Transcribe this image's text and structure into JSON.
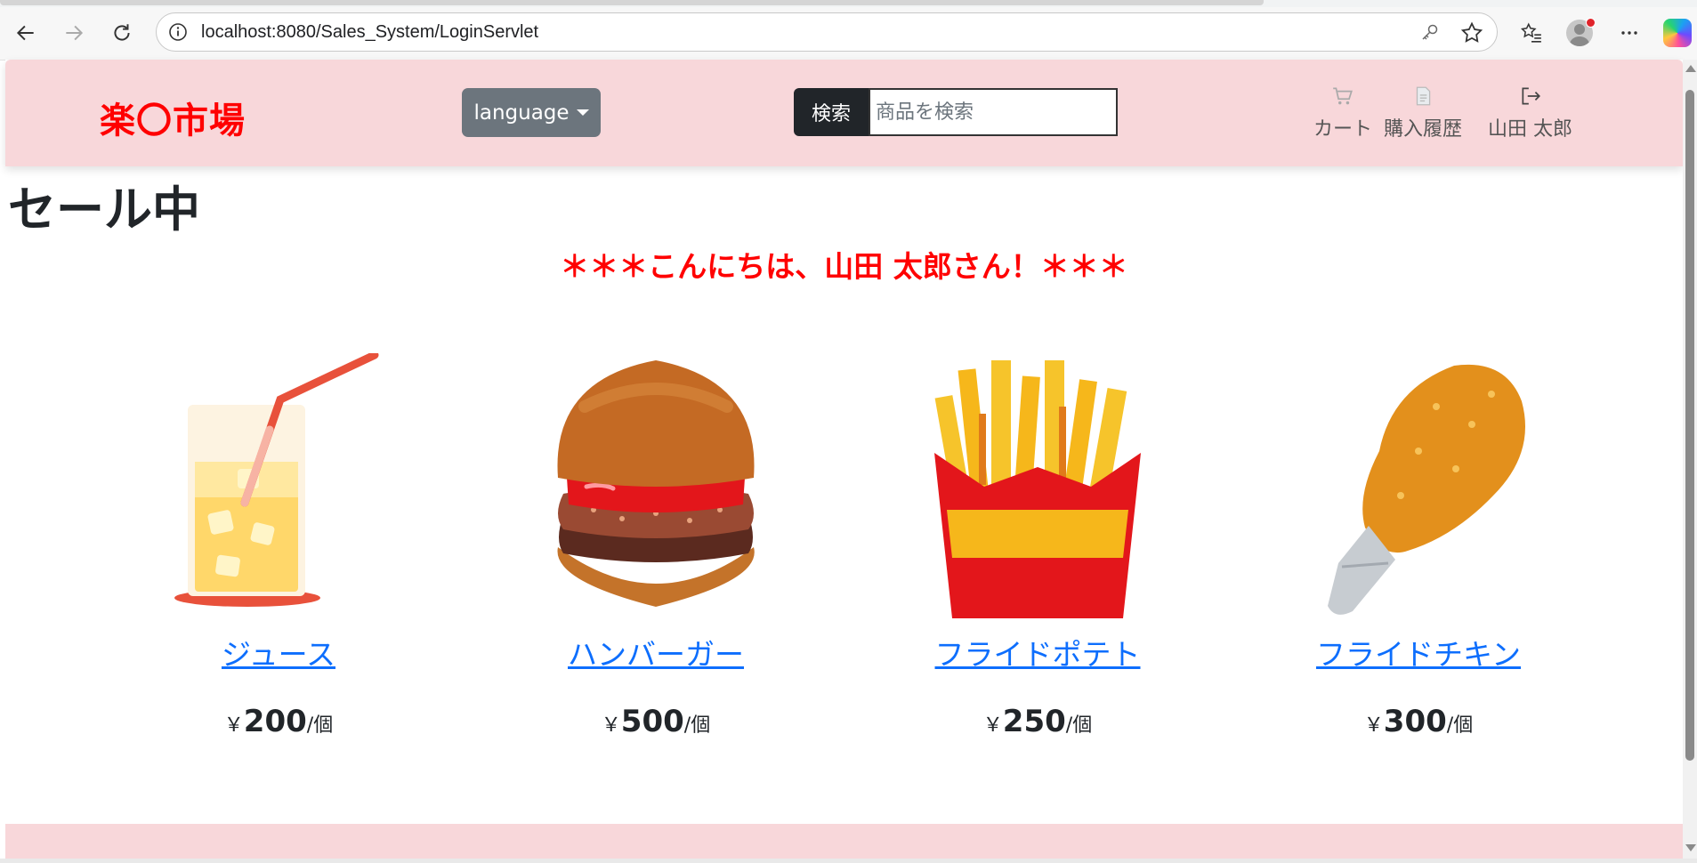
{
  "browser": {
    "url": "localhost:8080/Sales_System/LoginServlet"
  },
  "navbar": {
    "brand": "楽〇市場",
    "language_label": "language",
    "search_button_label": "検索",
    "search_placeholder": "商品を検索",
    "links": [
      {
        "label": "カート",
        "icon": "cart-icon"
      },
      {
        "label": "購入履歴",
        "icon": "document-icon"
      },
      {
        "label": "山田 太郎",
        "icon": "logout-icon"
      }
    ]
  },
  "main": {
    "heading": "セール中",
    "greeting": "＊＊＊こんにちは、山田 太郎さん！＊＊＊"
  },
  "products": [
    {
      "name": "ジュース",
      "currency": "￥",
      "price": "200",
      "unit": "/個",
      "icon": "juice-image"
    },
    {
      "name": "ハンバーガー",
      "currency": "￥",
      "price": "500",
      "unit": "/個",
      "icon": "hamburger-image"
    },
    {
      "name": "フライドポテト",
      "currency": "￥",
      "price": "250",
      "unit": "/個",
      "icon": "french-fries-image"
    },
    {
      "name": "フライドチキン",
      "currency": "￥",
      "price": "300",
      "unit": "/個",
      "icon": "fried-chicken-image"
    }
  ],
  "colors": {
    "brand": "#ff0000",
    "navbar_bg": "#f8d7da",
    "link": "#0d6efd",
    "lang_button": "#6c757d",
    "search_button": "#212529"
  }
}
